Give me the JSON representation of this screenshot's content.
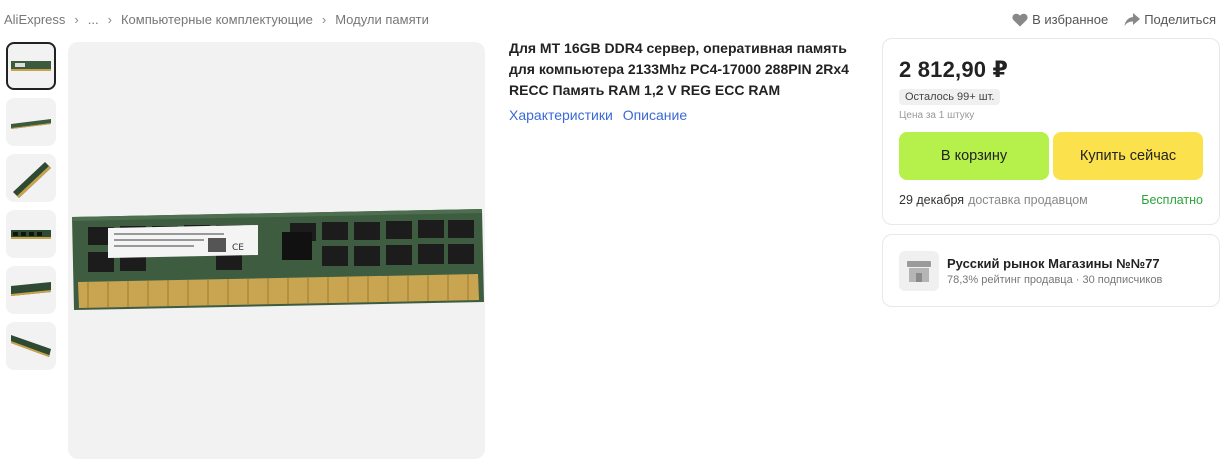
{
  "breadcrumb": {
    "items": [
      "AliExpress",
      "...",
      "Компьютерные комплектующие",
      "Модули памяти"
    ]
  },
  "actions": {
    "favorite_label": "В избранное",
    "share_label": "Поделиться"
  },
  "gallery": {
    "thumbnail_count": 6,
    "active_index": 0
  },
  "product": {
    "title": "Для MT 16GB DDR4 сервер, оперативная память для компьютера 2133Mhz PC4-17000 288PIN 2Rx4 RECC Память RAM 1,2 V REG ECC RAM",
    "link_specs": "Характеристики",
    "link_description": "Описание"
  },
  "purchase": {
    "price": "2 812,90 ₽",
    "stock": "Осталось 99+ шт.",
    "unit_note": "Цена за 1 штуку",
    "cart_label": "В корзину",
    "buy_label": "Купить сейчас",
    "delivery_date": "29 декабря",
    "delivery_method": "доставка продавцом",
    "delivery_price": "Бесплатно",
    "colors": {
      "cart": "#b6f04a",
      "buy": "#fbe14c",
      "free": "#2aa33a",
      "link": "#3a6ad6"
    }
  },
  "seller": {
    "name": "Русский рынок Магазины №№77",
    "rating": "78,3% рейтинг продавца",
    "subscribers": "30 подписчиков",
    "separator": "·"
  },
  "icons": {
    "favorite": "heart-icon",
    "share": "share-arrow-icon",
    "breadcrumb_separator": "chevron-right-icon",
    "seller_logo": "store-icon"
  }
}
